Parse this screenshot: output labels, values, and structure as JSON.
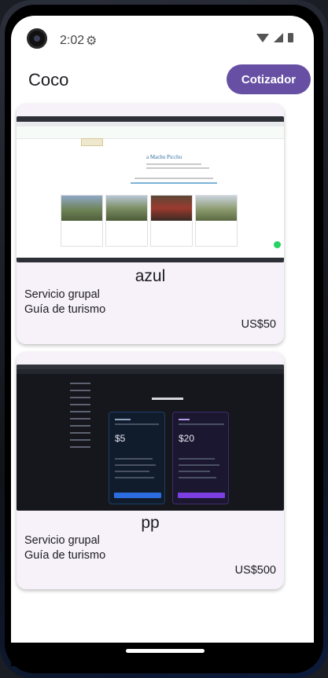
{
  "status_bar": {
    "time": "2:02"
  },
  "app": {
    "title": "Coco",
    "cotizador_label": "Cotizador"
  },
  "cards": [
    {
      "name": "azul",
      "type": "Servicio grupal",
      "description": "Guía de turismo",
      "price": "US$50",
      "preview": {
        "heading": "a Machu Picchu"
      }
    },
    {
      "name": "pp",
      "type": "Servicio grupal",
      "description": "Guía de turismo",
      "price": "US$500",
      "preview": {
        "hobby_price": "$5",
        "pro_price": "$20"
      }
    }
  ],
  "colors": {
    "accent": "#6750a4",
    "card_bg": "#f7f2fa",
    "hobby_button": "#2b6de0",
    "pro_button": "#7b3fe4"
  }
}
